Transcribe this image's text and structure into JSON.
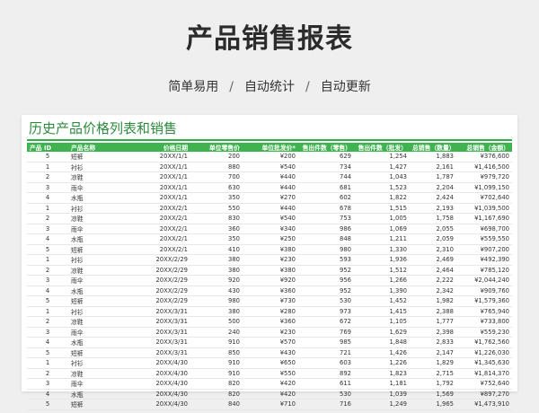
{
  "page": {
    "title": "产品销售报表",
    "subtitle": [
      "简单易用",
      "/",
      "自动统计",
      "/",
      "自动更新"
    ]
  },
  "sheet": {
    "title": "历史产品价格列表和销售",
    "accent_color": "#3fb34f",
    "headers": [
      "产品 ID",
      "产品名称",
      "价格日期",
      "单位零售价",
      "单位批发价*",
      "售出件数（零售）",
      "售出件数（批发）",
      "总销售（数量）",
      "总销售（金额）"
    ],
    "rows": [
      [
        "5",
        "短裤",
        "20XX/1/1",
        "200",
        "¥200",
        "629",
        "1,254",
        "1,883",
        "¥376,600"
      ],
      [
        "1",
        "衬衫",
        "20XX/1/1",
        "880",
        "¥540",
        "734",
        "1,427",
        "2,161",
        "¥1,416,500"
      ],
      [
        "2",
        "凉鞋",
        "20XX/1/1",
        "700",
        "¥440",
        "744",
        "1,043",
        "1,787",
        "¥979,720"
      ],
      [
        "3",
        "雨伞",
        "20XX/1/1",
        "630",
        "¥440",
        "681",
        "1,523",
        "2,204",
        "¥1,099,150"
      ],
      [
        "4",
        "水瓶",
        "20XX/1/1",
        "350",
        "¥270",
        "602",
        "1,822",
        "2,424",
        "¥702,640"
      ],
      [
        "1",
        "衬衫",
        "20XX/2/1",
        "550",
        "¥440",
        "678",
        "1,515",
        "2,193",
        "¥1,039,500"
      ],
      [
        "2",
        "凉鞋",
        "20XX/2/1",
        "830",
        "¥540",
        "753",
        "1,005",
        "1,758",
        "¥1,167,690"
      ],
      [
        "3",
        "雨伞",
        "20XX/2/1",
        "360",
        "¥340",
        "986",
        "1,069",
        "2,055",
        "¥698,700"
      ],
      [
        "4",
        "水瓶",
        "20XX/2/1",
        "350",
        "¥250",
        "848",
        "1,211",
        "2,059",
        "¥559,550"
      ],
      [
        "5",
        "短裤",
        "20XX/2/1",
        "410",
        "¥380",
        "980",
        "1,330",
        "2,310",
        "¥907,200"
      ],
      [
        "1",
        "衬衫",
        "20XX/2/29",
        "380",
        "¥230",
        "593",
        "1,936",
        "2,469",
        "¥492,390"
      ],
      [
        "2",
        "凉鞋",
        "20XX/2/29",
        "380",
        "¥380",
        "952",
        "1,512",
        "2,464",
        "¥785,120"
      ],
      [
        "3",
        "雨伞",
        "20XX/2/29",
        "920",
        "¥920",
        "956",
        "1,266",
        "2,222",
        "¥2,044,240"
      ],
      [
        "4",
        "水瓶",
        "20XX/2/29",
        "430",
        "¥360",
        "952",
        "1,390",
        "2,342",
        "¥909,760"
      ],
      [
        "5",
        "短裤",
        "20XX/2/29",
        "980",
        "¥730",
        "530",
        "1,452",
        "1,982",
        "¥1,579,360"
      ],
      [
        "1",
        "衬衫",
        "20XX/3/31",
        "380",
        "¥280",
        "973",
        "1,415",
        "2,388",
        "¥765,940"
      ],
      [
        "2",
        "凉鞋",
        "20XX/3/31",
        "500",
        "¥360",
        "672",
        "1,105",
        "1,777",
        "¥733,800"
      ],
      [
        "3",
        "雨伞",
        "20XX/3/31",
        "240",
        "¥230",
        "769",
        "1,629",
        "2,398",
        "¥559,230"
      ],
      [
        "4",
        "水瓶",
        "20XX/3/31",
        "910",
        "¥570",
        "985",
        "1,848",
        "2,833",
        "¥1,762,560"
      ],
      [
        "5",
        "短裤",
        "20XX/3/31",
        "850",
        "¥430",
        "721",
        "1,426",
        "2,147",
        "¥1,226,030"
      ],
      [
        "1",
        "衬衫",
        "20XX/4/30",
        "910",
        "¥650",
        "603",
        "1,226",
        "1,829",
        "¥1,345,630"
      ],
      [
        "2",
        "凉鞋",
        "20XX/4/30",
        "910",
        "¥550",
        "892",
        "1,823",
        "2,715",
        "¥1,814,370"
      ],
      [
        "3",
        "雨伞",
        "20XX/4/30",
        "820",
        "¥420",
        "611",
        "1,181",
        "1,792",
        "¥752,640"
      ],
      [
        "4",
        "水瓶",
        "20XX/4/30",
        "820",
        "¥420",
        "530",
        "1,039",
        "1,569",
        "¥897,270"
      ],
      [
        "5",
        "短裤",
        "20XX/4/30",
        "840",
        "¥710",
        "716",
        "1,249",
        "1,965",
        "¥1,473,910"
      ]
    ]
  }
}
